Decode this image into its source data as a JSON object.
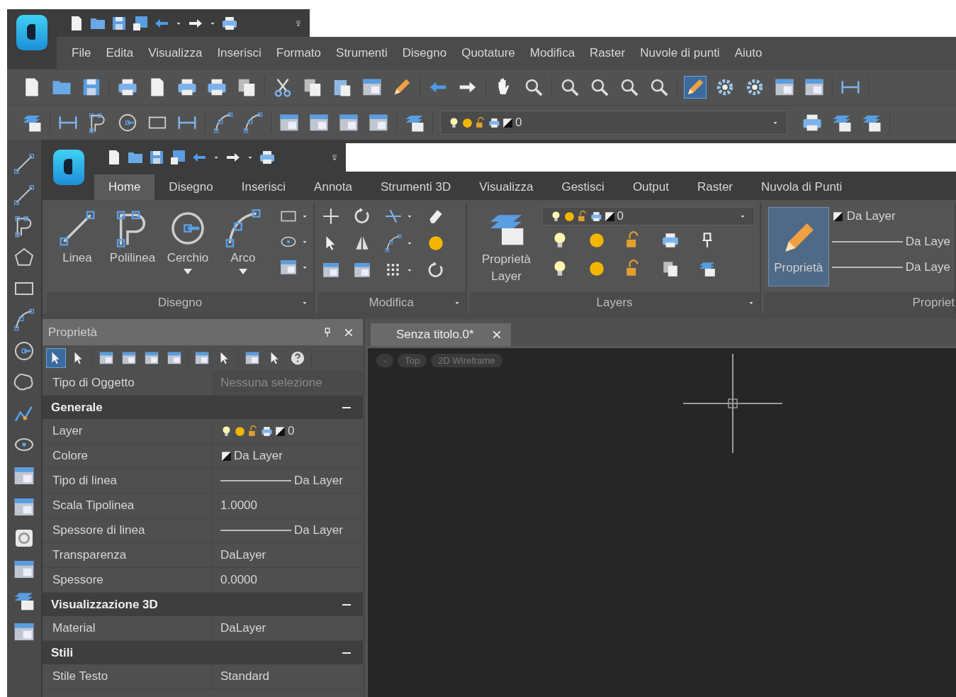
{
  "menu": [
    "File",
    "Edita",
    "Visualizza",
    "Inserisci",
    "Formato",
    "Strumenti",
    "Disegno",
    "Quotature",
    "Modifica",
    "Raster",
    "Nuvole di punti",
    "Aiuto"
  ],
  "layer_control": {
    "value": "0"
  },
  "ribbon": {
    "tabs": [
      {
        "label": "Home",
        "selected": true
      },
      {
        "label": "Disegno",
        "selected": false
      },
      {
        "label": "Inserisci",
        "selected": false
      },
      {
        "label": "Annota",
        "selected": false
      },
      {
        "label": "Strumenti 3D",
        "selected": false
      },
      {
        "label": "Visualizza",
        "selected": false
      },
      {
        "label": "Gestisci",
        "selected": false
      },
      {
        "label": "Output",
        "selected": false
      },
      {
        "label": "Raster",
        "selected": false
      },
      {
        "label": "Nuvola di Punti",
        "selected": false
      }
    ],
    "panels": [
      {
        "kind": "draw",
        "title": "Disegno",
        "tools": [
          {
            "label": "Linea",
            "dropdown": false
          },
          {
            "label": "Polilinea",
            "dropdown": false
          },
          {
            "label": "Cerchio",
            "dropdown": true
          },
          {
            "label": "Arco",
            "dropdown": true
          }
        ]
      },
      {
        "kind": "modify",
        "title": "Modifica"
      },
      {
        "kind": "layers",
        "title": "Layers",
        "button": "Proprietà Layer",
        "layer": "0"
      },
      {
        "kind": "properties",
        "title": "Propriet",
        "button": {
          "label": "Proprietà",
          "selected": true
        },
        "swatch_label": "Da Layer",
        "linetype": "Da Laye",
        "lineweight": "Da Laye"
      }
    ]
  },
  "properties_panel": {
    "title": "Proprietà",
    "rows": [
      {
        "kind": "row",
        "label": "Tipo di Oggetto",
        "value": {
          "kind": "text",
          "text": "Nessuna selezione"
        },
        "disabled": true
      },
      {
        "kind": "section",
        "label": "Generale",
        "expanded": true
      },
      {
        "kind": "row",
        "label": "Layer",
        "value": {
          "kind": "layer",
          "text": "0"
        },
        "disabled": false
      },
      {
        "kind": "row",
        "label": "Colore",
        "value": {
          "kind": "swatch",
          "text": "Da Layer"
        },
        "disabled": false
      },
      {
        "kind": "row",
        "label": "Tipo di linea",
        "value": {
          "kind": "line",
          "text": "Da Layer"
        },
        "disabled": false
      },
      {
        "kind": "row",
        "label": "Scala Tipolinea",
        "value": {
          "kind": "text",
          "text": "1.0000"
        },
        "disabled": false
      },
      {
        "kind": "row",
        "label": "Spessore di linea",
        "value": {
          "kind": "line",
          "text": "Da Layer"
        },
        "disabled": false
      },
      {
        "kind": "row",
        "label": "Transparenza",
        "value": {
          "kind": "text",
          "text": "DaLayer"
        },
        "disabled": false
      },
      {
        "kind": "row",
        "label": "Spessore",
        "value": {
          "kind": "text",
          "text": "0.0000"
        },
        "disabled": false
      },
      {
        "kind": "section",
        "label": "Visualizzazione 3D",
        "expanded": true
      },
      {
        "kind": "row",
        "label": "Material",
        "value": {
          "kind": "text",
          "text": "DaLayer"
        },
        "disabled": false
      },
      {
        "kind": "section",
        "label": "Stili",
        "expanded": true
      },
      {
        "kind": "row",
        "label": "Stile Testo",
        "value": {
          "kind": "text",
          "text": "Standard"
        },
        "disabled": false
      }
    ]
  },
  "document_tabs": [
    {
      "label": "Senza titolo.0*",
      "selected": true
    }
  ],
  "viewport_controls": [
    "-",
    "Top",
    "2D Wireframe"
  ]
}
